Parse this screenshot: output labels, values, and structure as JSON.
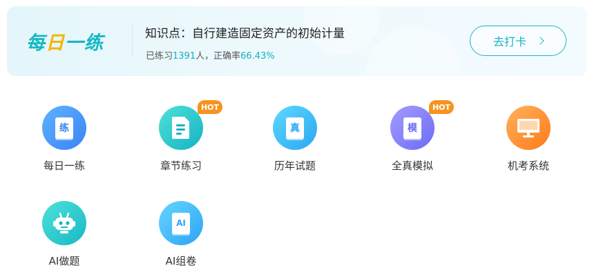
{
  "banner": {
    "brand_main": "每",
    "brand_accent": "日",
    "brand_tail": "一练",
    "topic": "知识点：自行建造固定资产的初始计量",
    "stats_prefix": "已练习",
    "practice_count": "1391",
    "stats_mid": "人，正确率",
    "accuracy": "66.43%",
    "checkin_label": "去打卡"
  },
  "tiles": [
    {
      "label": "每日一练",
      "glyph": "练",
      "hot": false,
      "color": "#3a84f5"
    },
    {
      "label": "章节练习",
      "glyph": "",
      "hot": true,
      "hot_label": "HOT",
      "color": "#14b3c4"
    },
    {
      "label": "历年试题",
      "glyph": "真",
      "hot": false,
      "color": "#2aa7f2"
    },
    {
      "label": "全真模拟",
      "glyph": "模",
      "hot": true,
      "hot_label": "HOT",
      "color": "#6b6cf6"
    },
    {
      "label": "机考系统",
      "glyph": "",
      "hot": false,
      "color": "#ff7a1a"
    },
    {
      "label": "AI做题",
      "glyph": "",
      "hot": false,
      "color": "#16b8c6"
    },
    {
      "label": "AI组卷",
      "glyph": "AI",
      "hot": false,
      "color": "#2da4f5"
    }
  ],
  "icons": [
    "daily-practice-icon",
    "chapter-document-icon",
    "past-exam-icon",
    "mock-exam-icon",
    "computer-monitor-icon",
    "robot-icon",
    "ai-paper-icon"
  ]
}
